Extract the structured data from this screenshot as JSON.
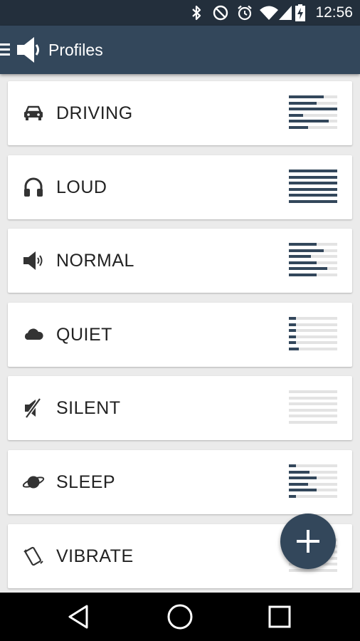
{
  "status_bar": {
    "time": "12:56",
    "icons": [
      "bluetooth-icon",
      "do-not-disturb-icon",
      "alarm-icon",
      "wifi-icon",
      "cell-signal-icon",
      "battery-charging-icon"
    ]
  },
  "app_bar": {
    "title": "Profiles",
    "icons": [
      "menu-icon",
      "speaker-icon"
    ]
  },
  "profiles": [
    {
      "label": "DRIVING",
      "icon": "car-icon",
      "levels": [
        0.72,
        0.58,
        1.0,
        0.3,
        0.82,
        0.4
      ]
    },
    {
      "label": "LOUD",
      "icon": "headphones-icon",
      "levels": [
        1.0,
        1.0,
        1.0,
        1.0,
        1.0,
        1.0
      ]
    },
    {
      "label": "NORMAL",
      "icon": "speaker-icon",
      "levels": [
        0.58,
        0.72,
        0.45,
        0.58,
        0.8,
        0.58
      ]
    },
    {
      "label": "QUIET",
      "icon": "cloud-icon",
      "levels": [
        0.15,
        0.15,
        0.15,
        0.15,
        0.15,
        0.2
      ]
    },
    {
      "label": "SILENT",
      "icon": "speaker-muted-icon",
      "levels": [
        0,
        0,
        0,
        0,
        0,
        0
      ]
    },
    {
      "label": "SLEEP",
      "icon": "planet-icon",
      "levels": [
        0.15,
        0.42,
        0.58,
        0.4,
        0.58,
        0.15
      ]
    },
    {
      "label": "VIBRATE",
      "icon": "vibrate-icon",
      "levels": [
        0,
        0,
        0,
        0,
        0,
        0
      ]
    }
  ],
  "fab": {
    "icon": "plus-icon"
  },
  "nav_bar": {
    "icons": [
      "back-icon",
      "home-icon",
      "recents-icon"
    ]
  },
  "colors": {
    "accent": "#33475b",
    "status_bar": "#232f3c",
    "track": "#e3e3e3",
    "background": "#ebebeb"
  }
}
